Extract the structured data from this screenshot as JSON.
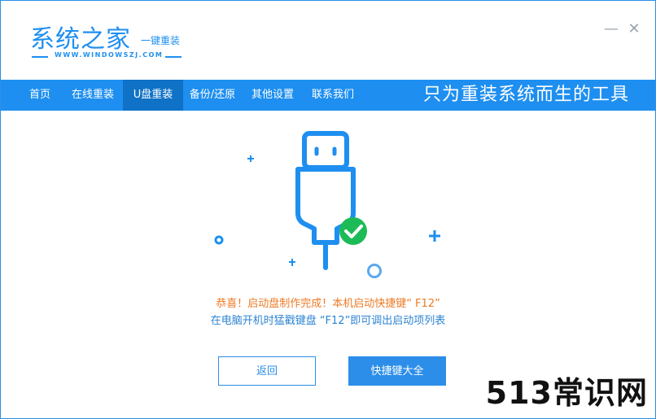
{
  "app": {
    "logo_title": "系统之家",
    "logo_subtitle": "一键重装",
    "logo_url": "WWW.WINDOWSZJ.COM",
    "minimize_glyph": "—",
    "close_glyph": "✕"
  },
  "nav": {
    "items": [
      {
        "label": "首页"
      },
      {
        "label": "在线重装"
      },
      {
        "label": "U盘重装",
        "active": true
      },
      {
        "label": "备份/还原"
      },
      {
        "label": "其他设置"
      },
      {
        "label": "联系我们"
      }
    ],
    "slogan": "只为重装系统而生的工具"
  },
  "main": {
    "illustration_icons": [
      "usb-cable-icon",
      "check-circle-icon"
    ],
    "message_line1": "恭喜！启动盘制作完成！本机启动快捷键“ F12”",
    "message_line2": "在电脑开机时猛戳键盘 “F12”即可调出启动项列表",
    "back_button": "返回",
    "shortcut_button": "快捷键大全"
  },
  "watermark": "513常识网",
  "colors": {
    "brand_blue": "#1e8ff0",
    "nav_active": "#0f72c7",
    "success_green": "#1dbb57",
    "message_orange": "#ec7a25",
    "message_blue": "#2c84d4"
  }
}
